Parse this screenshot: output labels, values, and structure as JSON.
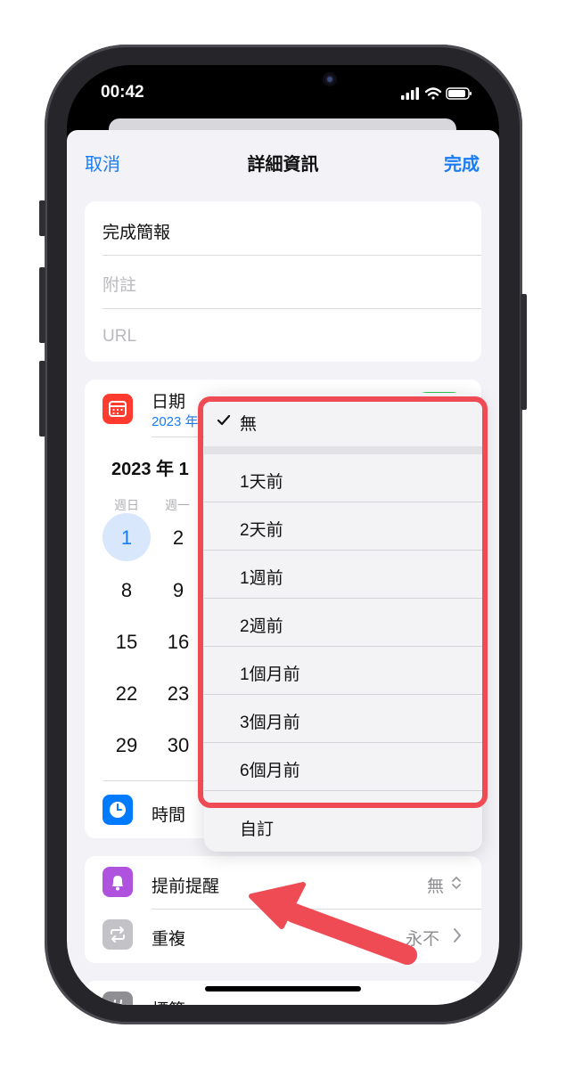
{
  "status": {
    "time": "00:42"
  },
  "nav": {
    "cancel": "取消",
    "title": "詳細資訊",
    "done": "完成"
  },
  "details": {
    "title_value": "完成簡報",
    "notes_placeholder": "附註",
    "url_placeholder": "URL"
  },
  "date": {
    "label": "日期",
    "sub": "2023 年",
    "month_header": "2023 年 1",
    "weekdays": [
      "週日",
      "週一"
    ],
    "days": [
      "1",
      "2",
      "8",
      "9",
      "15",
      "16",
      "22",
      "23",
      "29",
      "30"
    ],
    "selected_day": "1",
    "toggle_on": true
  },
  "time": {
    "label": "時間"
  },
  "alert": {
    "label": "提前提醒",
    "value": "無"
  },
  "repeat": {
    "label": "重複",
    "value": "永不"
  },
  "tags": {
    "label": "標籤"
  },
  "menu": {
    "selected": "無",
    "items": [
      "1天前",
      "2天前",
      "1週前",
      "2週前",
      "1個月前",
      "3個月前",
      "6個月前"
    ],
    "custom": "自訂"
  },
  "colors": {
    "accent": "#1a7cf5",
    "highlight": "#ef4b55",
    "calendar_icon": "#ff3b30",
    "time_icon": "#007aff",
    "alert_icon": "#af52de",
    "repeat_icon": "#8e8e93",
    "toggle": "#34c759"
  }
}
